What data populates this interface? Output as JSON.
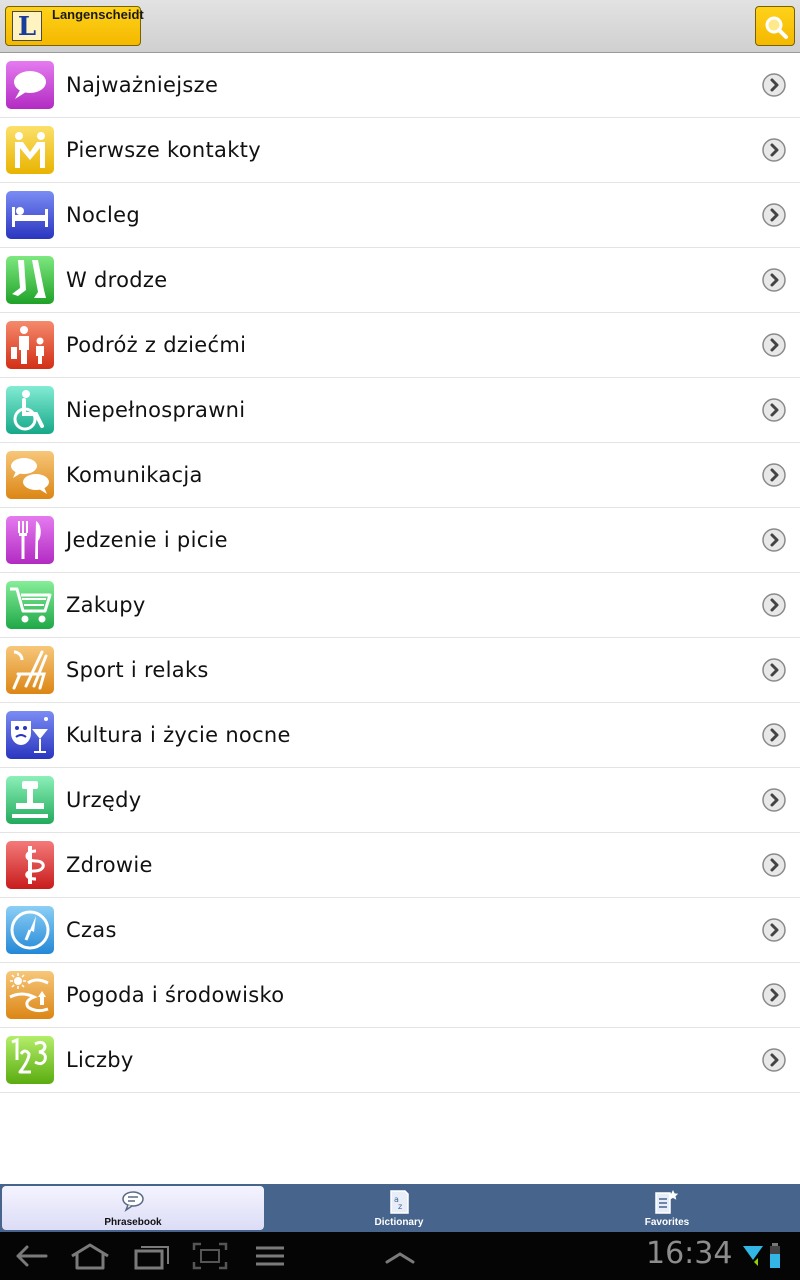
{
  "header": {
    "logo_letter": "L",
    "logo_text": "Langenscheidt"
  },
  "categories": [
    {
      "label": "Najważniejsze",
      "icon": "speech-bubble-icon",
      "color": "#c23ed0"
    },
    {
      "label": "Pierwsze kontakty",
      "icon": "handshake-people-icon",
      "color": "#f0c419"
    },
    {
      "label": "Nocleg",
      "icon": "bed-icon",
      "color": "#3d4fd6"
    },
    {
      "label": "W drodze",
      "icon": "walking-legs-icon",
      "color": "#34c23a"
    },
    {
      "label": "Podróż z dziećmi",
      "icon": "parent-child-icon",
      "color": "#e2472b"
    },
    {
      "label": "Niepełnosprawni",
      "icon": "wheelchair-icon",
      "color": "#33c8a8"
    },
    {
      "label": "Komunikacja",
      "icon": "chat-bubbles-icon",
      "color": "#e99a28"
    },
    {
      "label": "Jedzenie i picie",
      "icon": "fork-knife-icon",
      "color": "#c23ed0"
    },
    {
      "label": "Zakupy",
      "icon": "shopping-cart-icon",
      "color": "#34c25a"
    },
    {
      "label": "Sport i relaks",
      "icon": "deck-chair-icon",
      "color": "#e99a28"
    },
    {
      "label": "Kultura i życie nocne",
      "icon": "theater-masks-icon",
      "color": "#3d4fd6"
    },
    {
      "label": "Urzędy",
      "icon": "stamp-icon",
      "color": "#3ccb7a"
    },
    {
      "label": "Zdrowie",
      "icon": "medical-caduceus-icon",
      "color": "#e03131"
    },
    {
      "label": "Czas",
      "icon": "clock-icon",
      "color": "#3aa6e8"
    },
    {
      "label": "Pogoda i środowisko",
      "icon": "sun-landscape-icon",
      "color": "#e99a28"
    },
    {
      "label": "Liczby",
      "icon": "numbers-123-icon",
      "color": "#7cc924"
    }
  ],
  "tabs": [
    {
      "label": "Phrasebook",
      "icon": "phrasebook-icon",
      "active": true
    },
    {
      "label": "Dictionary",
      "icon": "dictionary-icon",
      "active": false
    },
    {
      "label": "Favorites",
      "icon": "favorites-icon",
      "active": false
    }
  ],
  "status": {
    "time": "16:34"
  }
}
